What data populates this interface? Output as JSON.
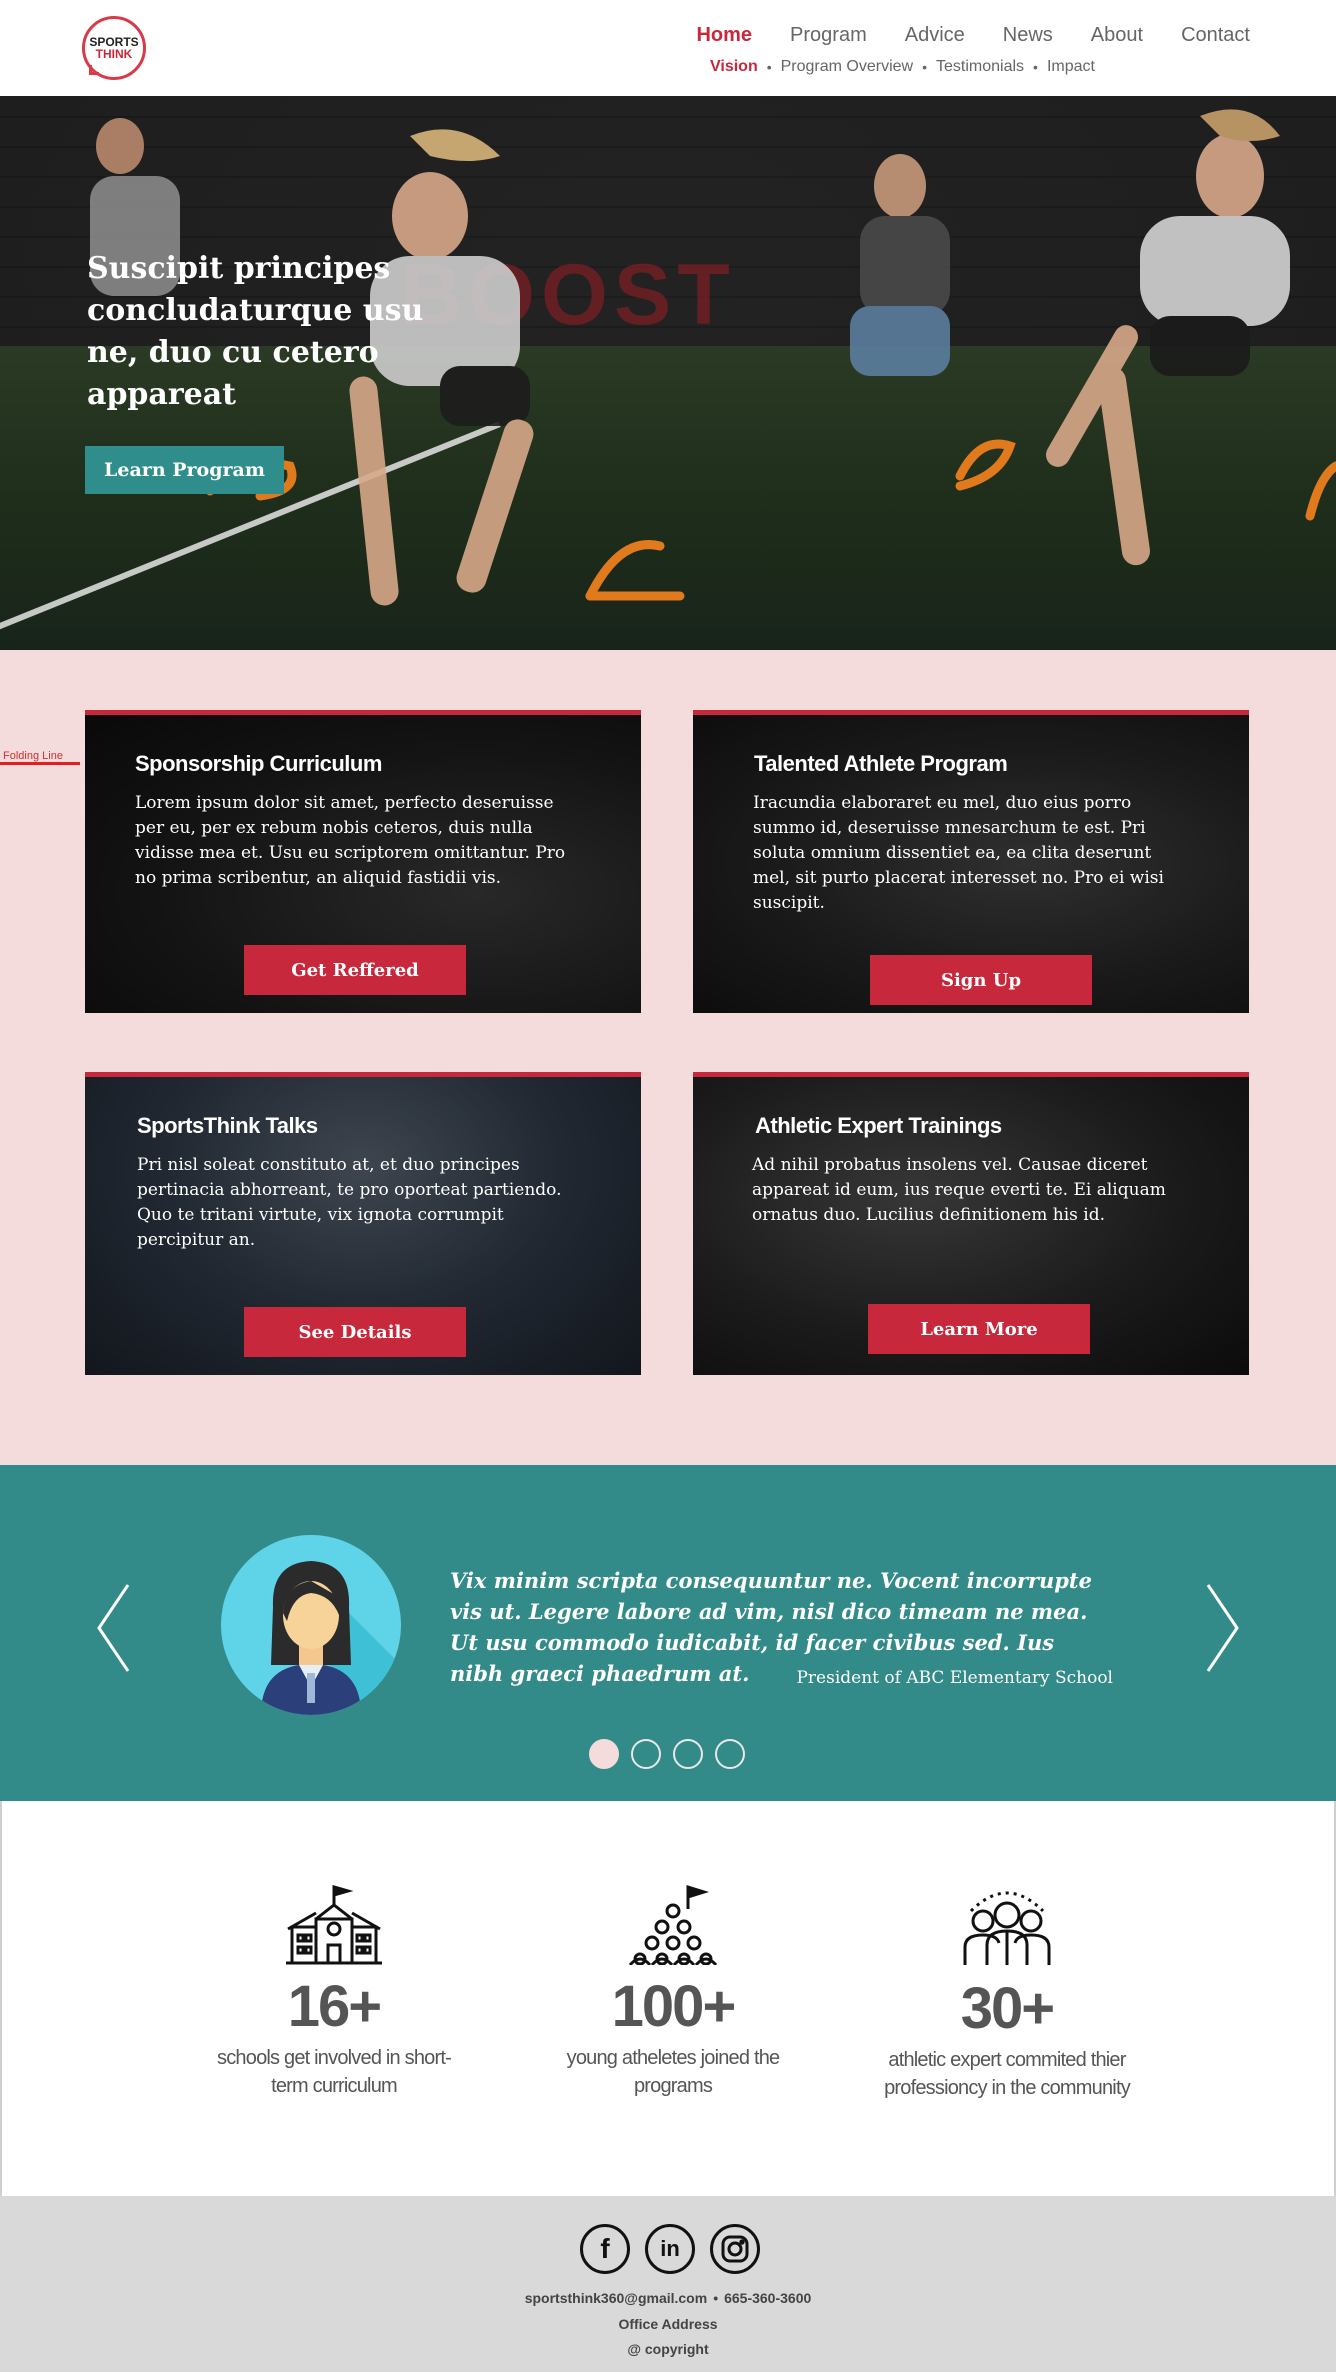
{
  "brand": {
    "logo_line1": "SPORTS",
    "logo_line2": "THINK"
  },
  "nav": {
    "items": [
      {
        "label": "Home",
        "active": true
      },
      {
        "label": "Program",
        "active": false
      },
      {
        "label": "Advice",
        "active": false
      },
      {
        "label": "News",
        "active": false
      },
      {
        "label": "About",
        "active": false
      },
      {
        "label": "Contact",
        "active": false
      }
    ],
    "subnav": [
      {
        "label": "Vision",
        "active": true
      },
      {
        "label": "Program Overview",
        "active": false
      },
      {
        "label": "Testimonials",
        "active": false
      },
      {
        "label": "Impact",
        "active": false
      }
    ],
    "separator": "•"
  },
  "hero": {
    "title": "Suscipit principes concludaturque usu ne, duo cu cetero appareat",
    "button": "Learn Program",
    "wall_text": "BOOST"
  },
  "fold_label": "Folding Line",
  "programs": [
    {
      "title": "Sponsorship Curriculum",
      "text": "Lorem ipsum dolor sit amet, perfecto deseruisse per eu, per ex rebum nobis ceteros, duis nulla vidisse mea et. Usu eu scriptorem omittantur. Pro no prima scribentur, an aliquid fastidii vis.",
      "button": "Get Reffered"
    },
    {
      "title": "Talented Athlete Program",
      "text": "Iracundia elaboraret eu mel, duo eius porro summo id, deseruisse mnesarchum te est. Pri soluta omnium dissentiet ea, ea clita deserunt mel, sit purto placerat interesset no. Pro ei wisi suscipit.",
      "button": "Sign Up"
    },
    {
      "title": "SportsThink Talks",
      "text": "Pri nisl soleat constituto at, et duo principes pertinacia abhorreant, te pro oporteat partiendo. Quo te tritani virtute, vix ignota corrumpit percipitur an.",
      "button": "See Details"
    },
    {
      "title": "Athletic Expert Trainings",
      "text": "Ad nihil probatus insolens vel. Causae diceret appareat id eum, ius reque everti te. Ei aliquam ornatus duo. Lucilius definitionem his id.",
      "button": "Learn More"
    }
  ],
  "testimonial": {
    "quote": "Vix minim scripta consequuntur ne. Vocent incorrupte vis ut. Legere labore ad vim, nisl dico timeam ne mea. Ut usu commodo iudicabit, id facer civibus sed. Ius nibh graeci phaedrum at.",
    "author": "President of ABC Elementary School",
    "slides": 4,
    "active_slide": 1
  },
  "stats": [
    {
      "icon": "school-icon",
      "number": "16+",
      "label": "schools get involved in short-term curriculum"
    },
    {
      "icon": "team-pyramid-icon",
      "number": "100+",
      "label": "young atheletes joined the  programs"
    },
    {
      "icon": "expert-group-icon",
      "number": "30+",
      "label": "athletic expert commited thier professioncy in the community"
    }
  ],
  "footer": {
    "socials": [
      "facebook-icon",
      "linkedin-icon",
      "instagram-icon"
    ],
    "email": "sportsthink360@gmail.com",
    "phone": "665-360-3600",
    "address": "Office Address",
    "copyright": "@ copyright"
  },
  "colors": {
    "accent_red": "#c8283b",
    "teal": "#338b89",
    "hero_button": "#2f8d8b",
    "pink_bg": "#f5dcdc",
    "footer_bg": "#d9d9d9"
  }
}
